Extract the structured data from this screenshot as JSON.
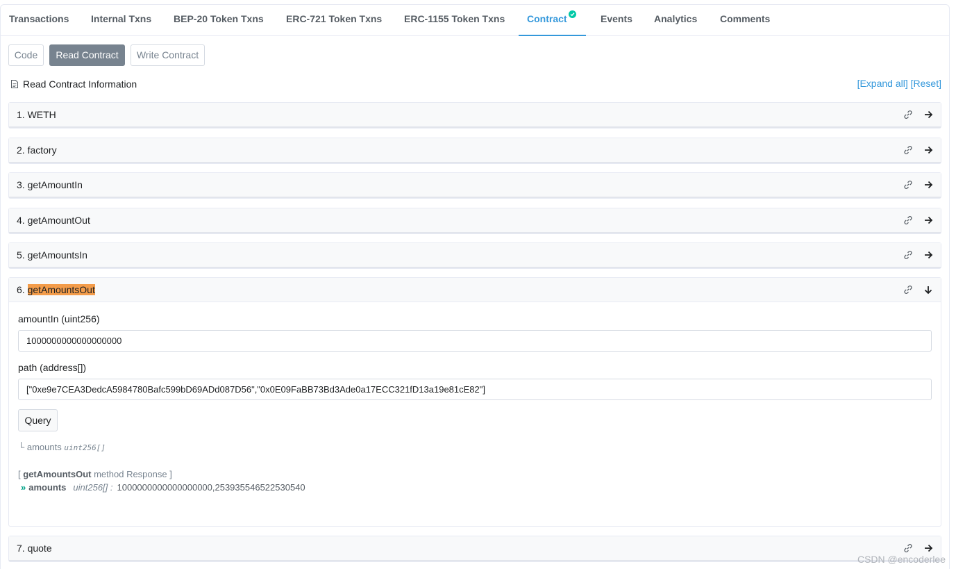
{
  "tabs": [
    {
      "label": "Transactions"
    },
    {
      "label": "Internal Txns"
    },
    {
      "label": "BEP-20 Token Txns"
    },
    {
      "label": "ERC-721 Token Txns"
    },
    {
      "label": "ERC-1155 Token Txns"
    },
    {
      "label": "Contract",
      "active": true,
      "verified_icon": "check-circle-icon"
    },
    {
      "label": "Events"
    },
    {
      "label": "Analytics"
    },
    {
      "label": "Comments"
    }
  ],
  "subtabs": [
    {
      "label": "Code"
    },
    {
      "label": "Read Contract",
      "active": true
    },
    {
      "label": "Write Contract"
    }
  ],
  "info": {
    "title": "Read Contract Information",
    "expand_all": "[Expand all]",
    "reset": "[Reset]"
  },
  "functions": [
    {
      "index": "1.",
      "name": "WETH"
    },
    {
      "index": "2.",
      "name": "factory"
    },
    {
      "index": "3.",
      "name": "getAmountIn"
    },
    {
      "index": "4.",
      "name": "getAmountOut"
    },
    {
      "index": "5.",
      "name": "getAmountsIn"
    },
    {
      "index": "6.",
      "name": "getAmountsOut",
      "expanded": true
    },
    {
      "index": "7.",
      "name": "quote"
    }
  ],
  "expanded": {
    "inputs": [
      {
        "label": "amountIn (uint256)",
        "value": "1000000000000000000"
      },
      {
        "label": "path (address[])",
        "value": "[\"0xe9e7CEA3DedcA5984780Bafc599bD69ADd087D56\",\"0x0E09FaBB73Bd3Ade0a17ECC321fD13a19e81cE82\"]"
      }
    ],
    "query_label": "Query",
    "return_prefix": "└",
    "return_name": "amounts",
    "return_type": "uint256[]",
    "response_open": "[",
    "response_fn": "getAmountsOut",
    "response_method": "method Response ]",
    "response_chevron": "»",
    "response_name": "amounts",
    "response_type": "uint256[] :",
    "response_value": "1000000000000000000,253935546522530540"
  },
  "colors": {
    "accent": "#3498db",
    "highlight": "#f39c4a",
    "verified": "#00c9a7",
    "chevron": "#00a186"
  },
  "watermark": "CSDN @encoderlee"
}
